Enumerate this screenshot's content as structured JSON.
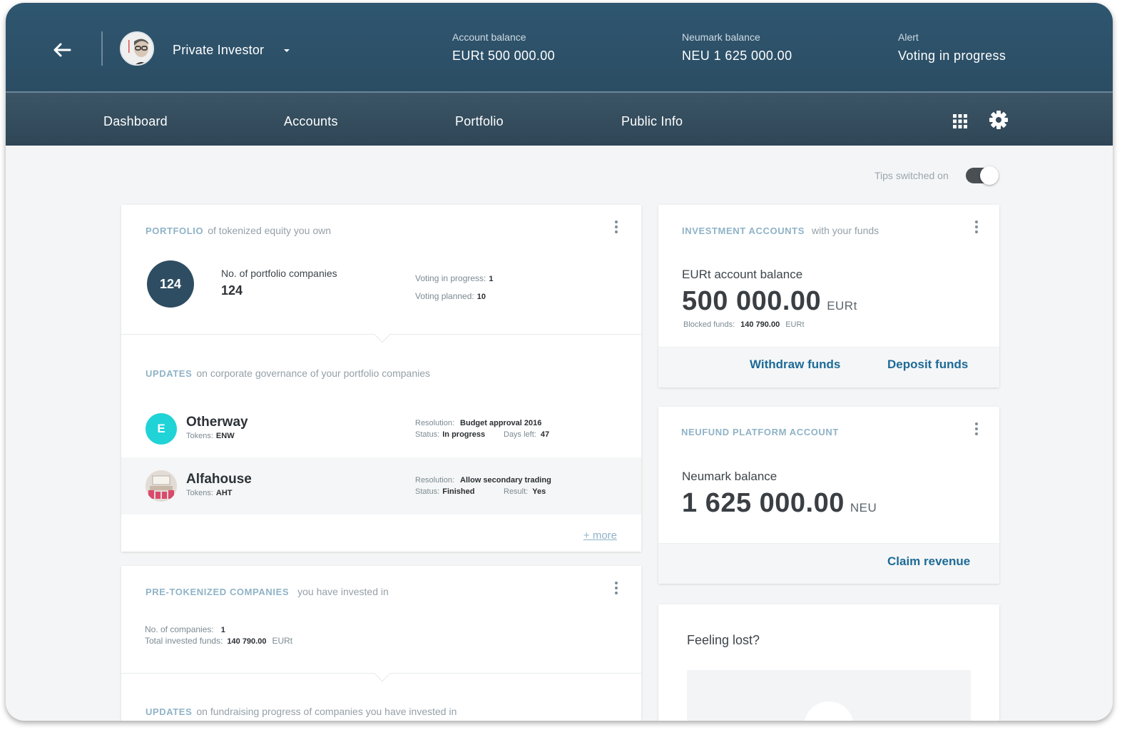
{
  "header": {
    "user_name": "Private Investor",
    "stats": [
      {
        "label": "Account balance",
        "value": "EURt 500 000.00"
      },
      {
        "label": "Neumark balance",
        "value": "NEU 1 625 000.00"
      },
      {
        "label": "Alert",
        "value": "Voting in progress"
      }
    ]
  },
  "nav": {
    "items": [
      "Dashboard",
      "Accounts",
      "Portfolio",
      "Public Info"
    ]
  },
  "tips": {
    "label": "Tips switched on",
    "enabled": true
  },
  "portfolio": {
    "title": "PORTFOLIO",
    "subtitle": "of tokenized equity you own",
    "badge": "124",
    "companies_label": "No. of portfolio companies",
    "companies_value": "124",
    "voting_in_progress_label": "Voting in progress:",
    "voting_in_progress_value": "1",
    "voting_planned_label": "Voting planned:",
    "voting_planned_value": "10",
    "updates_title": "UPDATES",
    "updates_subtitle": "on corporate governance of your portfolio companies",
    "updates": [
      {
        "logo_letter": "E",
        "logo_color": "#1fd3d6",
        "name": "Otherway",
        "tokens_label": "Tokens:",
        "tokens": "ENW",
        "resolution_label": "Resolution:",
        "resolution": "Budget approval 2016",
        "status_label": "Status:",
        "status": "In progress",
        "extra_label": "Days left:",
        "extra_value": "47"
      },
      {
        "logo_letter": "",
        "logo_color": "#d94a6c",
        "name": "Alfahouse",
        "tokens_label": "Tokens:",
        "tokens": "AHT",
        "resolution_label": "Resolution:",
        "resolution": "Allow secondary trading",
        "status_label": "Status:",
        "status": "Finished",
        "extra_label": "Result:",
        "extra_value": "Yes"
      }
    ],
    "more_label": "+ more"
  },
  "pretokenized": {
    "title": "PRE-TOKENIZED COMPANIES",
    "subtitle": "you have invested in",
    "companies_label": "No. of companies:",
    "companies_value": "1",
    "invested_label": "Total invested funds:",
    "invested_value": "140 790.00",
    "invested_unit": "EURt",
    "updates_title": "UPDATES",
    "updates_subtitle": "on fundraising progress of companies you have invested in"
  },
  "investment_accounts": {
    "title": "INVESTMENT ACCOUNTS",
    "subtitle": "with your funds",
    "balance_label": "EURt account balance",
    "balance_value": "500 000.00",
    "balance_unit": "EURt",
    "blocked_label": "Blocked funds:",
    "blocked_value": "140 790.00",
    "blocked_unit": "EURt",
    "withdraw_label": "Withdraw funds",
    "deposit_label": "Deposit funds"
  },
  "neufund_account": {
    "title": "NEUFUND PLATFORM ACCOUNT",
    "balance_label": "Neumark balance",
    "balance_value": "1 625 000.00",
    "balance_unit": "NEU",
    "claim_label": "Claim revenue"
  },
  "help": {
    "title": "Feeling lost?"
  }
}
